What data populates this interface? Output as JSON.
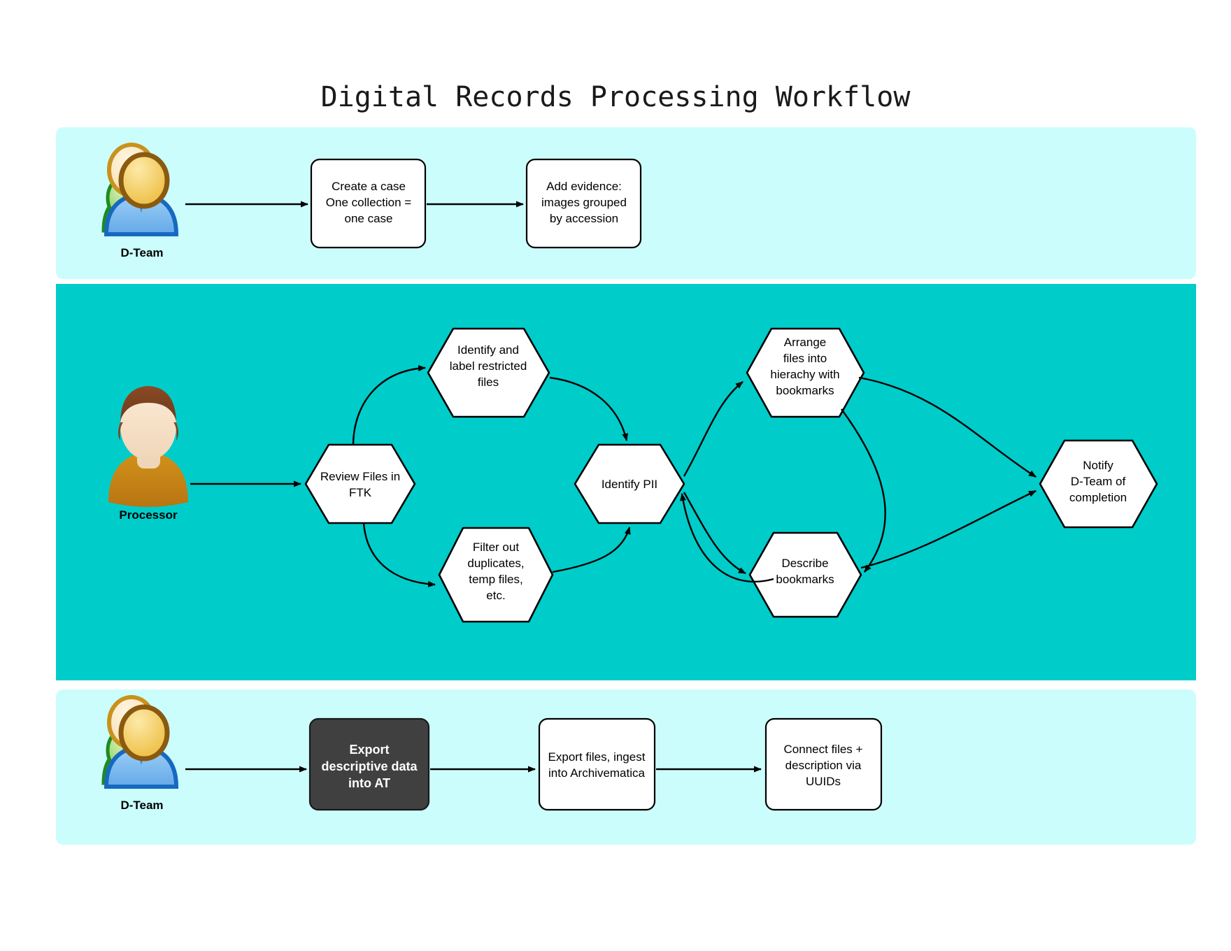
{
  "page": {
    "title": "Digital Records Processing Workflow",
    "background_color": "#ffffff"
  },
  "colors": {
    "lane_light": "#ccfdfd",
    "lane_bright": "#00ccca",
    "node_fill": "#ffffff",
    "node_stroke": "#000000",
    "highlight_fill": "#404040",
    "highlight_text": "#ffffff",
    "text": "#000000"
  },
  "lanes": [
    {
      "id": "lane-top",
      "actor": "D-Team",
      "actor_icon": "group-of-users-icon",
      "background": "#ccfdfd"
    },
    {
      "id": "lane-middle",
      "actor": "Processor",
      "actor_icon": "single-user-icon",
      "background": "#00ccca"
    },
    {
      "id": "lane-bottom",
      "actor": "D-Team",
      "actor_icon": "group-of-users-icon",
      "background": "#ccfdfd"
    }
  ],
  "nodes": {
    "create_case": {
      "shape": "rounded-rect",
      "lines": [
        "Create a case",
        "One collection =",
        "one case"
      ]
    },
    "add_evidence": {
      "shape": "rounded-rect",
      "lines": [
        "Add evidence:",
        "images grouped",
        "by accession"
      ]
    },
    "review_files": {
      "shape": "hexagon",
      "lines": [
        "Review Files in",
        "FTK"
      ]
    },
    "identify_restricted": {
      "shape": "hexagon",
      "lines": [
        "Identify and",
        "label restricted",
        "files"
      ]
    },
    "filter_duplicates": {
      "shape": "hexagon",
      "lines": [
        "Filter out",
        "duplicates,",
        "temp files,",
        "etc."
      ]
    },
    "identify_pii": {
      "shape": "hexagon",
      "lines": [
        "Identify PII"
      ]
    },
    "arrange_files": {
      "shape": "hexagon",
      "lines": [
        "Arrange",
        "files into",
        "hierachy with",
        "bookmarks"
      ]
    },
    "describe_bookmarks": {
      "shape": "hexagon",
      "lines": [
        "Describe",
        "bookmarks"
      ]
    },
    "notify_dteam": {
      "shape": "hexagon",
      "lines": [
        "Notify",
        "D-Team of",
        "completion"
      ]
    },
    "export_descriptive": {
      "shape": "rounded-rect-dark",
      "lines": [
        "Export",
        "descriptive data",
        "into AT"
      ]
    },
    "export_ingest": {
      "shape": "rounded-rect",
      "lines": [
        "Export files, ingest",
        "into Archivematica"
      ]
    },
    "connect_files": {
      "shape": "rounded-rect",
      "lines": [
        "Connect files +",
        "description via",
        "UUIDs"
      ]
    }
  },
  "actor_labels": {
    "dteam_top": "D-Team",
    "processor": "Processor",
    "dteam_bottom": "D-Team"
  },
  "edges": [
    {
      "from": "dteam-top-actor",
      "to": "create_case"
    },
    {
      "from": "create_case",
      "to": "add_evidence"
    },
    {
      "from": "processor-actor",
      "to": "review_files"
    },
    {
      "from": "review_files",
      "to": "identify_restricted"
    },
    {
      "from": "review_files",
      "to": "filter_duplicates"
    },
    {
      "from": "identify_restricted",
      "to": "identify_pii"
    },
    {
      "from": "filter_duplicates",
      "to": "identify_pii"
    },
    {
      "from": "identify_pii",
      "to": "arrange_files"
    },
    {
      "from": "identify_pii",
      "to": "describe_bookmarks"
    },
    {
      "from": "arrange_files",
      "to": "describe_bookmarks"
    },
    {
      "from": "arrange_files",
      "to": "notify_dteam"
    },
    {
      "from": "describe_bookmarks",
      "to": "notify_dteam"
    },
    {
      "from": "describe_bookmarks",
      "to": "identify_pii"
    },
    {
      "from": "dteam-bottom-actor",
      "to": "export_descriptive"
    },
    {
      "from": "export_descriptive",
      "to": "export_ingest"
    },
    {
      "from": "export_ingest",
      "to": "connect_files"
    }
  ]
}
